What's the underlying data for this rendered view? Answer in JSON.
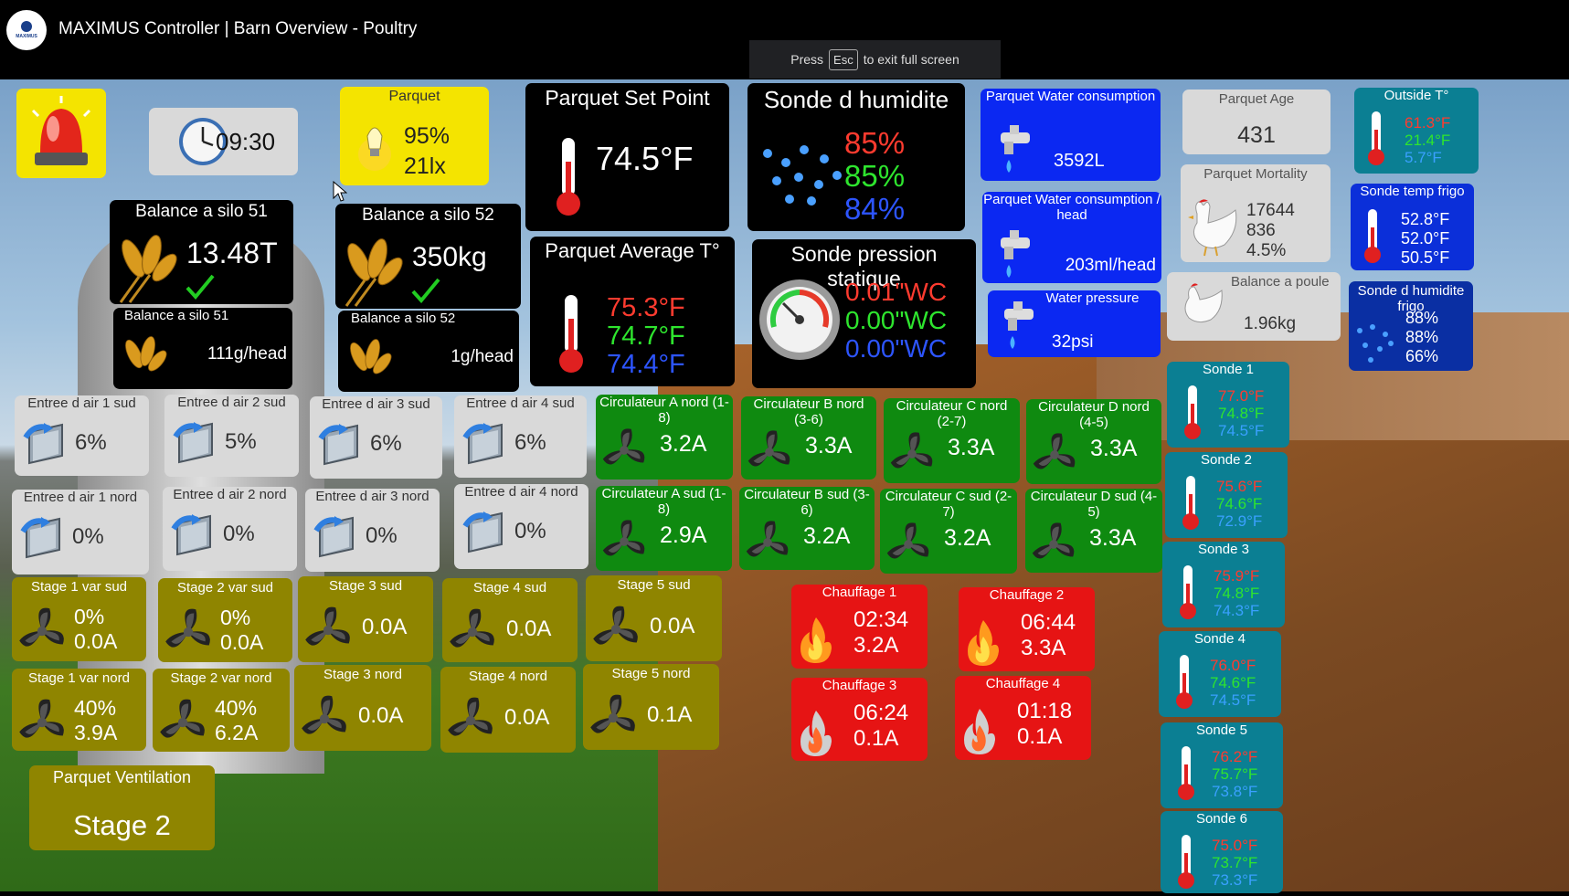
{
  "window": {
    "title": "MAXIMUS Controller | Barn Overview - Poultry",
    "logo_text": "MAXIMUS"
  },
  "fullscreen_notice": {
    "press": "Press",
    "key": "Esc",
    "rest": "to exit full screen"
  },
  "clock": {
    "time": "09:30"
  },
  "lights": {
    "title": "Parquet",
    "intensity": "95%",
    "lux": "21lx"
  },
  "set_point": {
    "title": "Parquet Set Point",
    "value": "74.5°F"
  },
  "humidity": {
    "title": "Sonde d humidite",
    "v1": "85%",
    "v2": "85%",
    "v3": "84%"
  },
  "water": {
    "title": "Parquet Water consumption",
    "value": "3592L"
  },
  "water_head": {
    "title": "Parquet Water consumption / head",
    "value": "203ml/head"
  },
  "water_pressure": {
    "title": "Water pressure",
    "value": "32psi"
  },
  "age": {
    "title": "Parquet Age",
    "value": "431"
  },
  "mortality": {
    "title": "Parquet Mortality",
    "v1": "17644",
    "v2": "836",
    "v3": "4.5%"
  },
  "bird_scale": {
    "title": "Balance a poule",
    "value": "1.96kg"
  },
  "outside_temp": {
    "title": "Outside T°",
    "v1": "61.3°F",
    "v2": "21.4°F",
    "v3": "5.7°F"
  },
  "fridge_temp": {
    "title": "Sonde temp frigo",
    "v1": "52.8°F",
    "v2": "52.0°F",
    "v3": "50.5°F"
  },
  "fridge_humidity": {
    "title": "Sonde d humidite frigo",
    "v1": "88%",
    "v2": "88%",
    "v3": "66%"
  },
  "silo51": {
    "title": "Balance a silo 51",
    "value": "13.48T",
    "sub_title": "Balance a silo 51",
    "sub_value": "111g/head"
  },
  "silo52": {
    "title": "Balance a silo 52",
    "value": "350kg",
    "sub_title": "Balance a silo 52",
    "sub_value": "1g/head"
  },
  "avg_temp": {
    "title": "Parquet Average T°",
    "v1": "75.3°F",
    "v2": "74.7°F",
    "v3": "74.4°F"
  },
  "pressure": {
    "title": "Sonde pression statique",
    "v1": "0.01\"WC",
    "v2": "0.00\"WC",
    "v3": "0.00\"WC"
  },
  "inlets": [
    {
      "label": "Entree d air 1 sud",
      "value": "6%"
    },
    {
      "label": "Entree d air 2 sud",
      "value": "5%"
    },
    {
      "label": "Entree d air 3 sud",
      "value": "6%"
    },
    {
      "label": "Entree d air 4 sud",
      "value": "6%"
    },
    {
      "label": "Entree d air 1 nord",
      "value": "0%"
    },
    {
      "label": "Entree d air 2 nord",
      "value": "0%"
    },
    {
      "label": "Entree d air 3 nord",
      "value": "0%"
    },
    {
      "label": "Entree d air 4 nord",
      "value": "0%"
    }
  ],
  "circulators": [
    {
      "label": "Circulateur A nord (1-8)",
      "value": "3.2A"
    },
    {
      "label": "Circulateur B nord (3-6)",
      "value": "3.3A"
    },
    {
      "label": "Circulateur C nord (2-7)",
      "value": "3.3A"
    },
    {
      "label": "Circulateur D nord (4-5)",
      "value": "3.3A"
    },
    {
      "label": "Circulateur A sud (1-8)",
      "value": "2.9A"
    },
    {
      "label": "Circulateur B sud (3-6)",
      "value": "3.2A"
    },
    {
      "label": "Circulateur C sud (2-7)",
      "value": "3.2A"
    },
    {
      "label": "Circulateur D sud (4-5)",
      "value": "3.3A"
    }
  ],
  "stages": [
    {
      "label": "Stage 1 var sud",
      "v1": "0%",
      "v2": "0.0A"
    },
    {
      "label": "Stage 2 var sud",
      "v1": "0%",
      "v2": "0.0A"
    },
    {
      "label": "Stage 3 sud",
      "v1": "",
      "v2": "0.0A"
    },
    {
      "label": "Stage 4 sud",
      "v1": "",
      "v2": "0.0A"
    },
    {
      "label": "Stage 5 sud",
      "v1": "",
      "v2": "0.0A"
    },
    {
      "label": "Stage 1 var nord",
      "v1": "40%",
      "v2": "3.9A"
    },
    {
      "label": "Stage 2 var nord",
      "v1": "40%",
      "v2": "6.2A"
    },
    {
      "label": "Stage 3 nord",
      "v1": "",
      "v2": "0.0A"
    },
    {
      "label": "Stage 4 nord",
      "v1": "",
      "v2": "0.0A"
    },
    {
      "label": "Stage 5 nord",
      "v1": "",
      "v2": "0.1A"
    }
  ],
  "heaters": [
    {
      "label": "Chauffage 1",
      "time": "02:34",
      "amps": "3.2A"
    },
    {
      "label": "Chauffage 2",
      "time": "06:44",
      "amps": "3.3A"
    },
    {
      "label": "Chauffage 3",
      "time": "06:24",
      "amps": "0.1A"
    },
    {
      "label": "Chauffage 4",
      "time": "01:18",
      "amps": "0.1A"
    }
  ],
  "probes": [
    {
      "label": "Sonde 1",
      "v1": "77.0°F",
      "v2": "74.8°F",
      "v3": "74.5°F"
    },
    {
      "label": "Sonde 2",
      "v1": "75.6°F",
      "v2": "74.6°F",
      "v3": "72.9°F"
    },
    {
      "label": "Sonde 3",
      "v1": "75.9°F",
      "v2": "74.8°F",
      "v3": "74.3°F"
    },
    {
      "label": "Sonde 4",
      "v1": "76.0°F",
      "v2": "74.6°F",
      "v3": "74.5°F"
    },
    {
      "label": "Sonde 5",
      "v1": "76.2°F",
      "v2": "75.7°F",
      "v3": "73.8°F"
    },
    {
      "label": "Sonde 6",
      "v1": "75.0°F",
      "v2": "73.7°F",
      "v3": "73.3°F"
    }
  ],
  "ventilation": {
    "title": "Parquet Ventilation",
    "value": "Stage 2"
  },
  "colors": {
    "yellow": "#f4e400",
    "blue": "#0b28f2",
    "green": "#0f8a10",
    "olive": "#8f8500",
    "red": "#e61414",
    "teal": "#0b7f93"
  }
}
